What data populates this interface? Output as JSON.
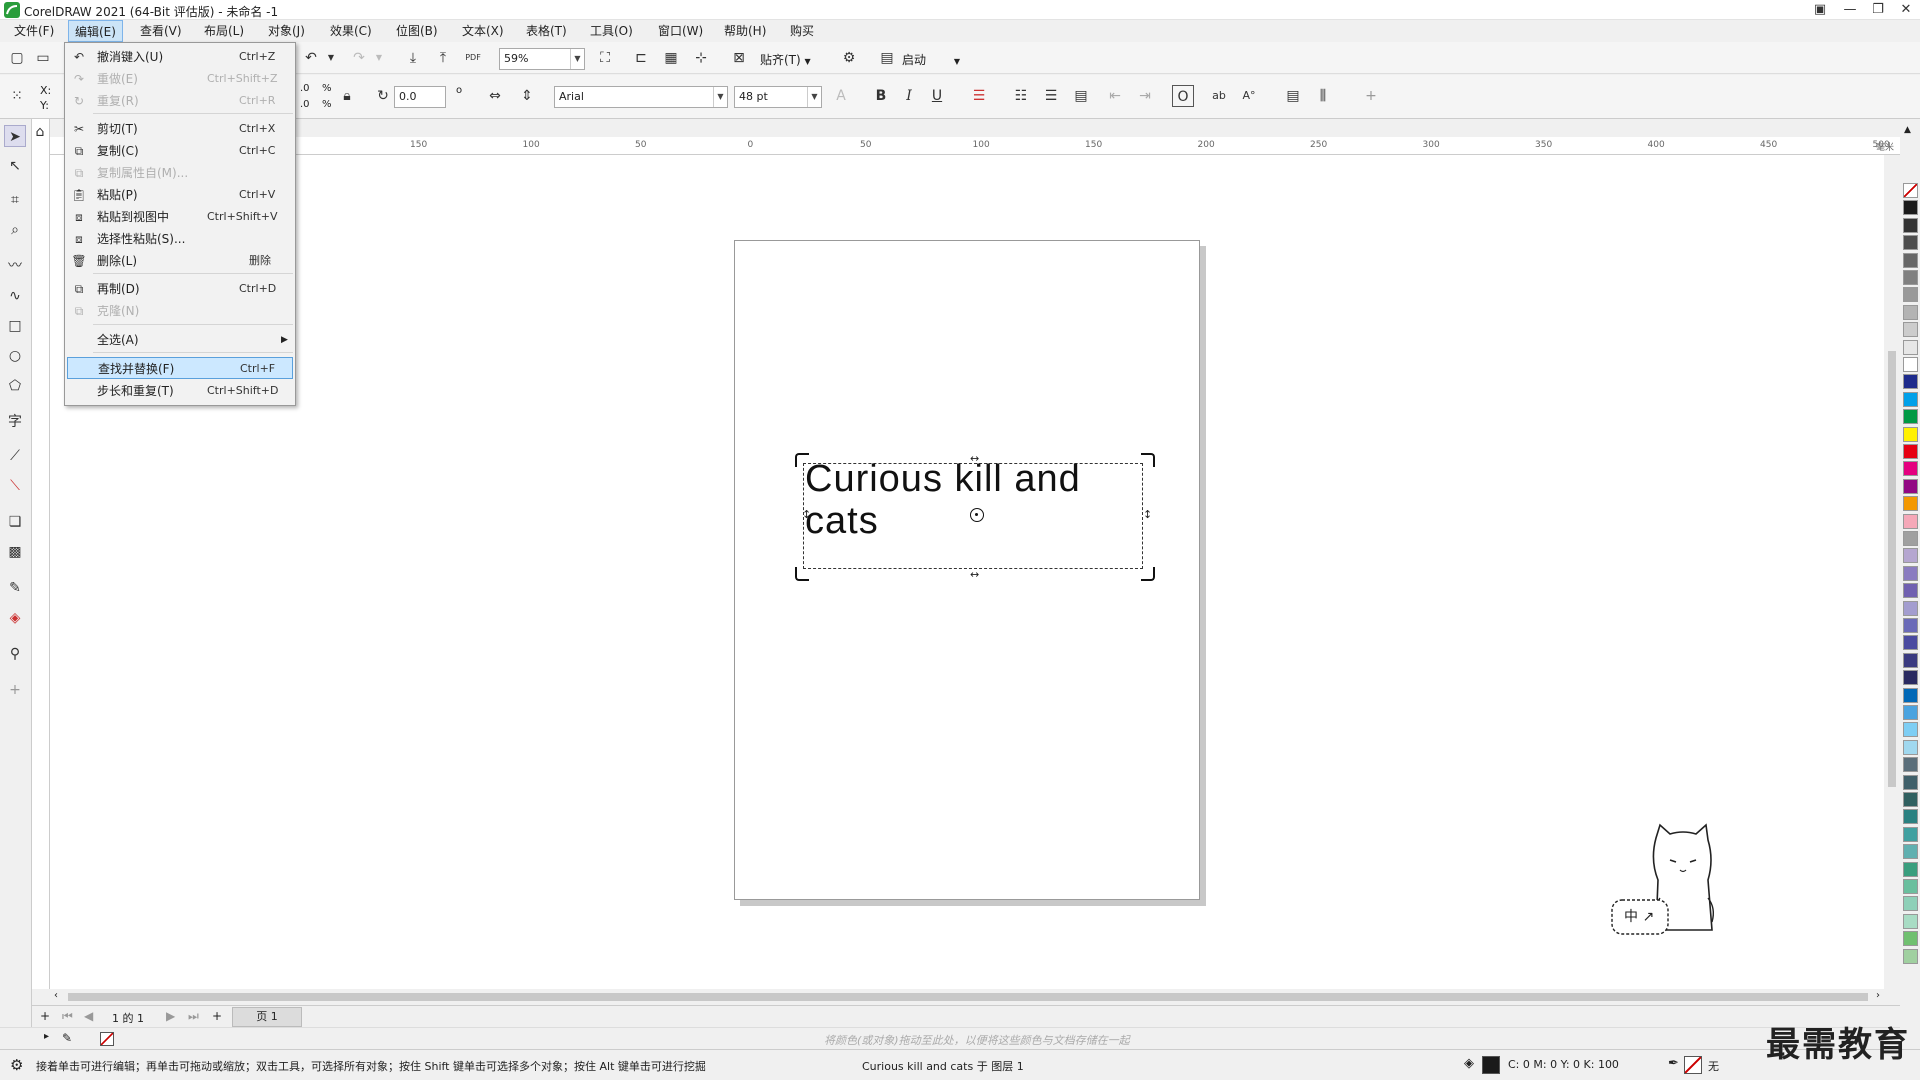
{
  "window": {
    "title": "CorelDRAW 2021 (64-Bit 评估版) - 未命名 -1"
  },
  "menubar": [
    {
      "label": "文件(F)",
      "active": false
    },
    {
      "label": "编辑(E)",
      "active": true
    },
    {
      "label": "查看(V)",
      "active": false
    },
    {
      "label": "布局(L)",
      "active": false
    },
    {
      "label": "对象(J)",
      "active": false
    },
    {
      "label": "效果(C)",
      "active": false
    },
    {
      "label": "位图(B)",
      "active": false
    },
    {
      "label": "文本(X)",
      "active": false
    },
    {
      "label": "表格(T)",
      "active": false
    },
    {
      "label": "工具(O)",
      "active": false
    },
    {
      "label": "窗口(W)",
      "active": false
    },
    {
      "label": "帮助(H)",
      "active": false
    },
    {
      "label": "购买",
      "active": false
    }
  ],
  "toolbar1": {
    "zoom": "59%",
    "snap_label": "贴齐(T)",
    "launch_label": "启动",
    "pdf_label": "PDF"
  },
  "toolbar2": {
    "x_label": "X:",
    "y_label": "Y:",
    "pos_x": ".0",
    "pos_y": ".0",
    "pct1": "%",
    "pct2": "%",
    "angle": "0.0",
    "degree": "o",
    "font": "Arial",
    "size": "48 pt"
  },
  "edit_menu": {
    "items": [
      {
        "label": "撤消键入(U)",
        "shortcut": "Ctrl+Z",
        "disabled": false,
        "icon": "undo-icon"
      },
      {
        "label": "重做(E)",
        "shortcut": "Ctrl+Shift+Z",
        "disabled": true,
        "icon": "redo-icon"
      },
      {
        "label": "重复(R)",
        "shortcut": "Ctrl+R",
        "disabled": true,
        "icon": "repeat-icon"
      },
      {
        "label": "剪切(T)",
        "shortcut": "Ctrl+X",
        "disabled": false,
        "icon": "cut-icon"
      },
      {
        "label": "复制(C)",
        "shortcut": "Ctrl+C",
        "disabled": false,
        "icon": "copy-icon"
      },
      {
        "label": "复制属性自(M)...",
        "shortcut": "",
        "disabled": true,
        "icon": "copy-properties-icon"
      },
      {
        "label": "粘贴(P)",
        "shortcut": "Ctrl+V",
        "disabled": false,
        "icon": "paste-icon"
      },
      {
        "label": "粘贴到视图中",
        "shortcut": "Ctrl+Shift+V",
        "disabled": false,
        "icon": "paste-in-view-icon"
      },
      {
        "label": "选择性粘贴(S)...",
        "shortcut": "",
        "disabled": false,
        "icon": "paste-special-icon"
      },
      {
        "label": "删除(L)",
        "shortcut": "删除",
        "disabled": false,
        "icon": "trash-icon"
      },
      {
        "label": "再制(D)",
        "shortcut": "Ctrl+D",
        "disabled": false,
        "icon": "duplicate-icon"
      },
      {
        "label": "克隆(N)",
        "shortcut": "",
        "disabled": true,
        "icon": "clone-icon"
      },
      {
        "label": "全选(A)",
        "shortcut": "",
        "disabled": false,
        "icon": "",
        "submenu": true
      },
      {
        "label": "查找并替换(F)",
        "shortcut": "Ctrl+F",
        "disabled": false,
        "icon": "",
        "highlighted": true
      },
      {
        "label": "步长和重复(T)",
        "shortcut": "Ctrl+Shift+D",
        "disabled": false,
        "icon": ""
      }
    ]
  },
  "hruler": {
    "labels": [
      "150",
      "100",
      "50",
      "0",
      "50",
      "100",
      "150",
      "200",
      "250",
      "300",
      "350",
      "400",
      "450",
      "500"
    ],
    "unit": "毫米"
  },
  "canvas": {
    "text_line1": "Curious kill and",
    "text_line2": "cats"
  },
  "pagebar": {
    "page_of": "1 的 1",
    "page_tab": "页 1"
  },
  "colorbar": {
    "hint": "将颜色(或对象)拖动至此处，以便将这些颜色与文档存储在一起"
  },
  "statusbar": {
    "message": "接着单击可进行编辑；再单击可拖动或缩放；双击工具，可选择所有对象；按住 Shift 键单击可选择多个对象；按住 Alt 键单击可进行挖掘",
    "selection": "Curious kill and cats 于 图层 1",
    "cmyk": "C:  0 M:  0 Y:  0 K:  100",
    "outline": "无"
  },
  "sticker": {
    "label": "中 ↗"
  },
  "watermark": "最需教育",
  "palette": [
    "#ffffff",
    "#1a1a1a",
    "#333333",
    "#4d4d4d",
    "#666666",
    "#808080",
    "#999999",
    "#b3b3b3",
    "#cccccc",
    "#e6e6e6",
    "#ffffff",
    "#1e2b8c",
    "#00a0e9",
    "#009944",
    "#fff100",
    "#e60012",
    "#e4007f",
    "#920783",
    "#f39800",
    "#f5a8b8",
    "#a0a0a0",
    "#b5a6d0",
    "#8a7bc0",
    "#7060b0",
    "#a39dcf",
    "#6a6ab8",
    "#4a4aa0",
    "#3a3a80",
    "#2a2a60",
    "#0068b7",
    "#4aa3df",
    "#7ecef4",
    "#a0d8ef",
    "#5a6e7a",
    "#40606a",
    "#306060",
    "#2a8080",
    "#40a0a0",
    "#60b0b0",
    "#3a9e7e",
    "#6abf9e",
    "#8ed0b8",
    "#a8dcc4",
    "#70c070",
    "#a0d0a0"
  ]
}
